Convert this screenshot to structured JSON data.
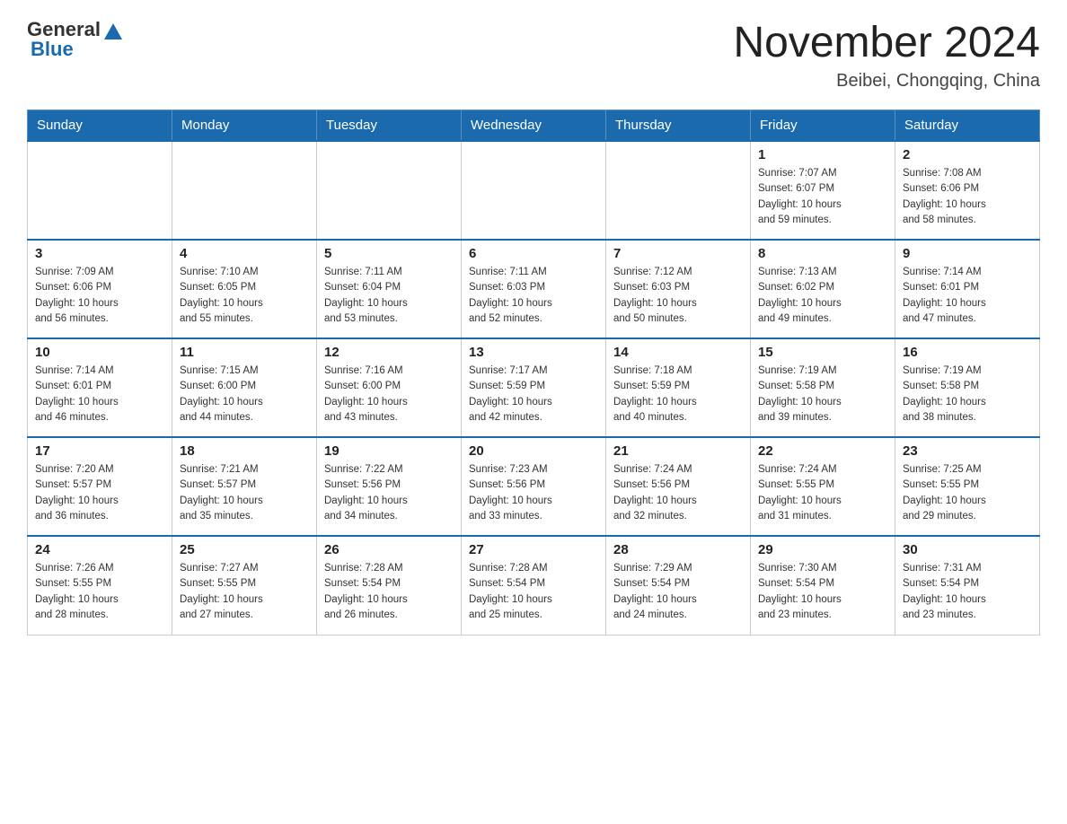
{
  "header": {
    "logo_general": "General",
    "logo_blue": "Blue",
    "month_title": "November 2024",
    "location": "Beibei, Chongqing, China"
  },
  "weekdays": [
    "Sunday",
    "Monday",
    "Tuesday",
    "Wednesday",
    "Thursday",
    "Friday",
    "Saturday"
  ],
  "weeks": [
    [
      {
        "day": "",
        "info": ""
      },
      {
        "day": "",
        "info": ""
      },
      {
        "day": "",
        "info": ""
      },
      {
        "day": "",
        "info": ""
      },
      {
        "day": "",
        "info": ""
      },
      {
        "day": "1",
        "info": "Sunrise: 7:07 AM\nSunset: 6:07 PM\nDaylight: 10 hours\nand 59 minutes."
      },
      {
        "day": "2",
        "info": "Sunrise: 7:08 AM\nSunset: 6:06 PM\nDaylight: 10 hours\nand 58 minutes."
      }
    ],
    [
      {
        "day": "3",
        "info": "Sunrise: 7:09 AM\nSunset: 6:06 PM\nDaylight: 10 hours\nand 56 minutes."
      },
      {
        "day": "4",
        "info": "Sunrise: 7:10 AM\nSunset: 6:05 PM\nDaylight: 10 hours\nand 55 minutes."
      },
      {
        "day": "5",
        "info": "Sunrise: 7:11 AM\nSunset: 6:04 PM\nDaylight: 10 hours\nand 53 minutes."
      },
      {
        "day": "6",
        "info": "Sunrise: 7:11 AM\nSunset: 6:03 PM\nDaylight: 10 hours\nand 52 minutes."
      },
      {
        "day": "7",
        "info": "Sunrise: 7:12 AM\nSunset: 6:03 PM\nDaylight: 10 hours\nand 50 minutes."
      },
      {
        "day": "8",
        "info": "Sunrise: 7:13 AM\nSunset: 6:02 PM\nDaylight: 10 hours\nand 49 minutes."
      },
      {
        "day": "9",
        "info": "Sunrise: 7:14 AM\nSunset: 6:01 PM\nDaylight: 10 hours\nand 47 minutes."
      }
    ],
    [
      {
        "day": "10",
        "info": "Sunrise: 7:14 AM\nSunset: 6:01 PM\nDaylight: 10 hours\nand 46 minutes."
      },
      {
        "day": "11",
        "info": "Sunrise: 7:15 AM\nSunset: 6:00 PM\nDaylight: 10 hours\nand 44 minutes."
      },
      {
        "day": "12",
        "info": "Sunrise: 7:16 AM\nSunset: 6:00 PM\nDaylight: 10 hours\nand 43 minutes."
      },
      {
        "day": "13",
        "info": "Sunrise: 7:17 AM\nSunset: 5:59 PM\nDaylight: 10 hours\nand 42 minutes."
      },
      {
        "day": "14",
        "info": "Sunrise: 7:18 AM\nSunset: 5:59 PM\nDaylight: 10 hours\nand 40 minutes."
      },
      {
        "day": "15",
        "info": "Sunrise: 7:19 AM\nSunset: 5:58 PM\nDaylight: 10 hours\nand 39 minutes."
      },
      {
        "day": "16",
        "info": "Sunrise: 7:19 AM\nSunset: 5:58 PM\nDaylight: 10 hours\nand 38 minutes."
      }
    ],
    [
      {
        "day": "17",
        "info": "Sunrise: 7:20 AM\nSunset: 5:57 PM\nDaylight: 10 hours\nand 36 minutes."
      },
      {
        "day": "18",
        "info": "Sunrise: 7:21 AM\nSunset: 5:57 PM\nDaylight: 10 hours\nand 35 minutes."
      },
      {
        "day": "19",
        "info": "Sunrise: 7:22 AM\nSunset: 5:56 PM\nDaylight: 10 hours\nand 34 minutes."
      },
      {
        "day": "20",
        "info": "Sunrise: 7:23 AM\nSunset: 5:56 PM\nDaylight: 10 hours\nand 33 minutes."
      },
      {
        "day": "21",
        "info": "Sunrise: 7:24 AM\nSunset: 5:56 PM\nDaylight: 10 hours\nand 32 minutes."
      },
      {
        "day": "22",
        "info": "Sunrise: 7:24 AM\nSunset: 5:55 PM\nDaylight: 10 hours\nand 31 minutes."
      },
      {
        "day": "23",
        "info": "Sunrise: 7:25 AM\nSunset: 5:55 PM\nDaylight: 10 hours\nand 29 minutes."
      }
    ],
    [
      {
        "day": "24",
        "info": "Sunrise: 7:26 AM\nSunset: 5:55 PM\nDaylight: 10 hours\nand 28 minutes."
      },
      {
        "day": "25",
        "info": "Sunrise: 7:27 AM\nSunset: 5:55 PM\nDaylight: 10 hours\nand 27 minutes."
      },
      {
        "day": "26",
        "info": "Sunrise: 7:28 AM\nSunset: 5:54 PM\nDaylight: 10 hours\nand 26 minutes."
      },
      {
        "day": "27",
        "info": "Sunrise: 7:28 AM\nSunset: 5:54 PM\nDaylight: 10 hours\nand 25 minutes."
      },
      {
        "day": "28",
        "info": "Sunrise: 7:29 AM\nSunset: 5:54 PM\nDaylight: 10 hours\nand 24 minutes."
      },
      {
        "day": "29",
        "info": "Sunrise: 7:30 AM\nSunset: 5:54 PM\nDaylight: 10 hours\nand 23 minutes."
      },
      {
        "day": "30",
        "info": "Sunrise: 7:31 AM\nSunset: 5:54 PM\nDaylight: 10 hours\nand 23 minutes."
      }
    ]
  ]
}
